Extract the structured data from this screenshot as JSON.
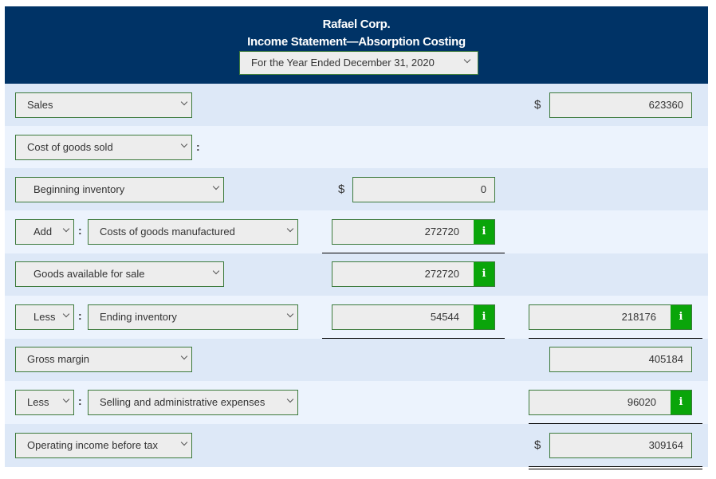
{
  "header": {
    "company": "Rafael Corp.",
    "statement_title": "Income Statement—Absorption Costing",
    "period_select": "For the Year Ended December 31, 2020"
  },
  "currency_symbol": "$",
  "info_glyph": "i",
  "rows": {
    "sales": {
      "label": "Sales",
      "col2": "623360"
    },
    "cogs": {
      "label": "Cost of goods sold"
    },
    "beginning_inventory": {
      "label": "Beginning inventory",
      "col1": "0"
    },
    "cogm": {
      "operator": "Add",
      "label": "Costs of goods manufactured",
      "col1": "272720"
    },
    "goods_available": {
      "label": "Goods available for sale",
      "col1": "272720"
    },
    "ending_inventory": {
      "operator": "Less",
      "label": "Ending inventory",
      "col1": "54544",
      "col2": "218176"
    },
    "gross_margin": {
      "label": "Gross margin",
      "col2": "405184"
    },
    "sga": {
      "operator": "Less",
      "label": "Selling and administrative expenses",
      "col2": "96020"
    },
    "operating_income": {
      "label": "Operating income before tax",
      "col2": "309164"
    }
  },
  "colors": {
    "header_bg": "#003366",
    "row_alt_1": "#dde8f7",
    "row_alt_2": "#ecf3fd",
    "field_border": "#3c7a3c",
    "info_button": "#0aa50a"
  }
}
